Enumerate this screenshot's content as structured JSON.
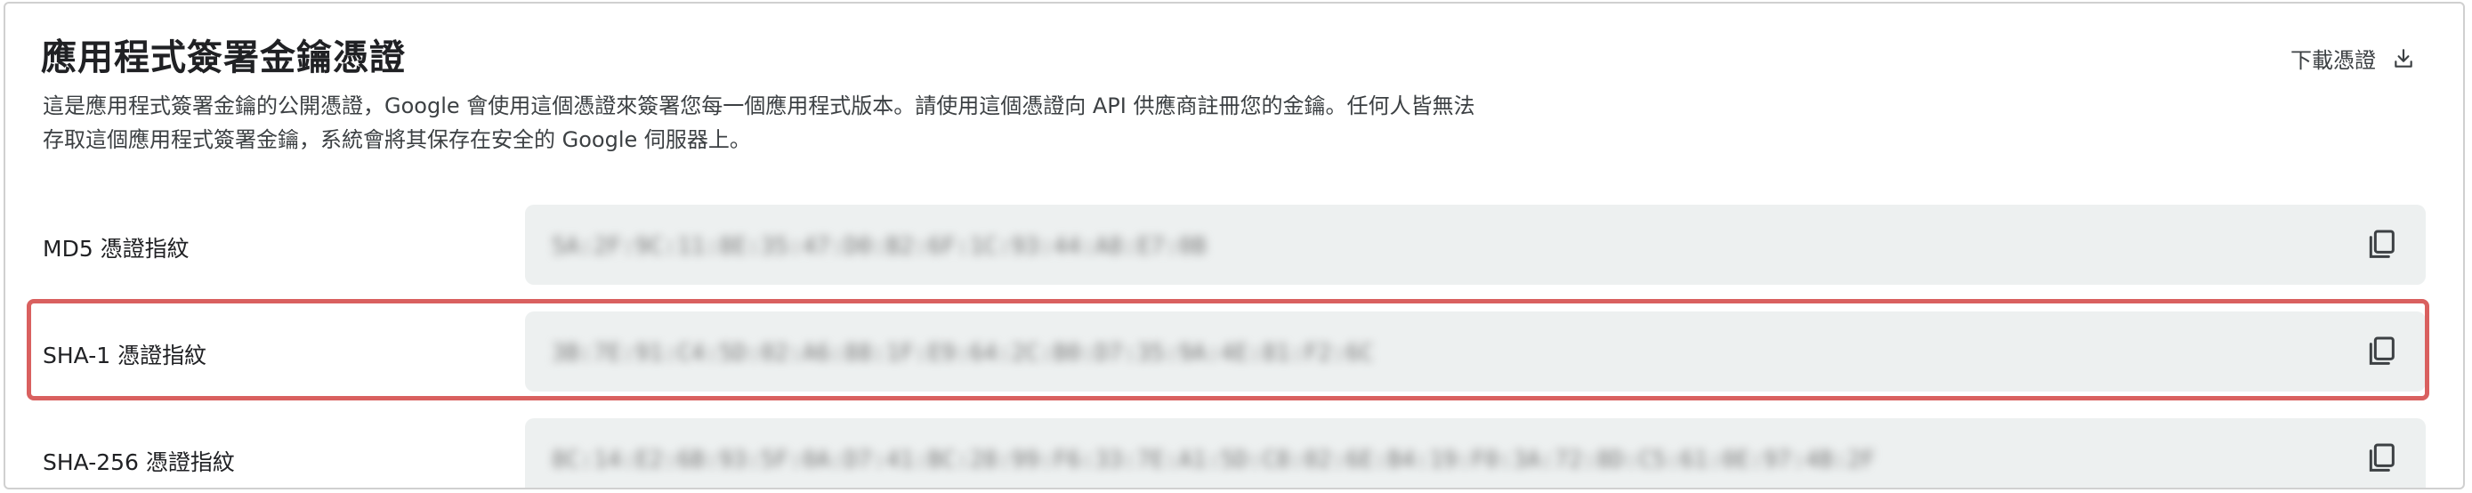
{
  "header": {
    "title": "應用程式簽署金鑰憑證",
    "download_label": "下載憑證",
    "download_icon": "download-icon"
  },
  "description": "這是應用程式簽署金鑰的公開憑證，Google 會使用這個憑證來簽署您每一個應用程式版本。請使用這個憑證向 API 供應商註冊您的金鑰。任何人皆無法存取這個應用程式簽署金鑰，系統會將其保存在安全的 Google 伺服器上。",
  "fingerprints": [
    {
      "label": "MD5 憑證指紋",
      "value": "5A:2F:9C:11:8E:35:47:D0:B2:6F:1C:93:44:A8:E7:0B",
      "copy_icon": "copy-icon"
    },
    {
      "label": "SHA-1 憑證指紋",
      "value": "3B:7E:91:C4:5D:02:A6:88:1F:E9:64:2C:B0:D7:35:9A:4E:81:F2:6C",
      "copy_icon": "copy-icon",
      "highlighted": true
    },
    {
      "label": "SHA-256 憑證指紋",
      "value": "8C:14:E2:6B:93:5F:0A:D7:41:BC:28:99:F6:33:7E:A1:5D:C8:02:6E:B4:19:F0:3A:72:8D:C5:61:0E:97:4B:2F",
      "copy_icon": "copy-icon"
    }
  ],
  "colors": {
    "highlight_border": "#d9605f",
    "value_background": "#edf0f0"
  }
}
